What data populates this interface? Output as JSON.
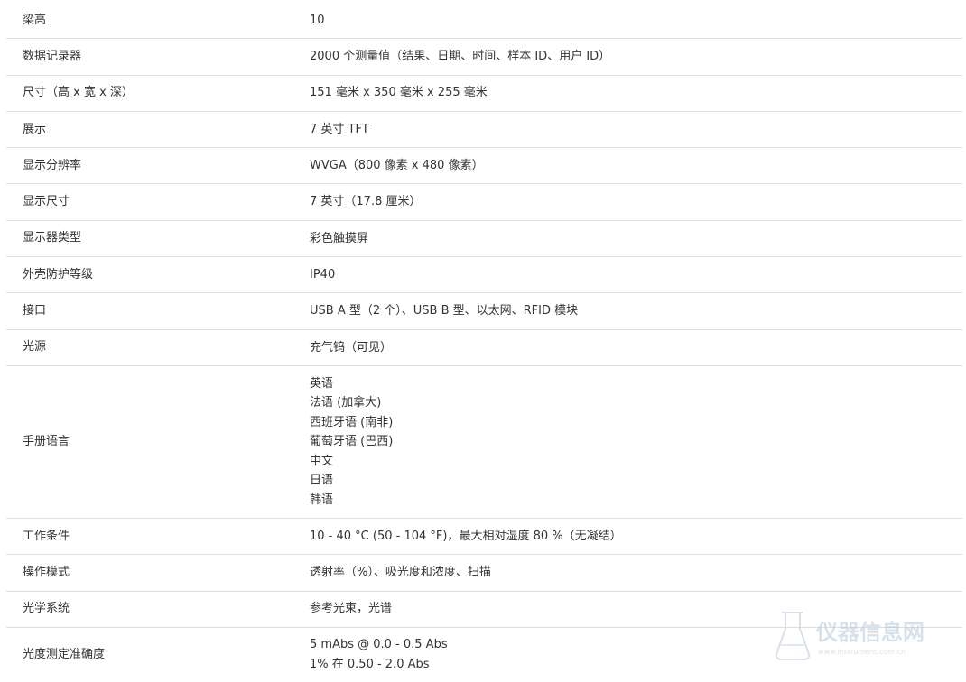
{
  "rows": [
    {
      "label": "梁高",
      "value": "10"
    },
    {
      "label": "数据记录器",
      "value": "2000 个测量值（结果、日期、时间、样本 ID、用户 ID）"
    },
    {
      "label": "尺寸（高 x 宽 x 深）",
      "value": "151 毫米 x 350 毫米 x 255 毫米"
    },
    {
      "label": "展示",
      "value": "7 英寸 TFT"
    },
    {
      "label": "显示分辨率",
      "value": "WVGA（800 像素 x 480 像素）"
    },
    {
      "label": "显示尺寸",
      "value": "7 英寸（17.8 厘米）"
    },
    {
      "label": "显示器类型",
      "value": "彩色触摸屏"
    },
    {
      "label": "外壳防护等级",
      "value": "IP40"
    },
    {
      "label": "接口",
      "value": "USB A 型（2 个）、USB B 型、以太网、RFID 模块"
    },
    {
      "label": "光源",
      "value": "充气钨（可见）"
    },
    {
      "label": "手册语言",
      "values": [
        "英语",
        "法语 (加拿大)",
        "西班牙语 (南非)",
        "葡萄牙语 (巴西)",
        "中文",
        "日语",
        "韩语"
      ]
    },
    {
      "label": "工作条件",
      "value": "10 - 40 °C (50 - 104 °F)，最大相对湿度 80 %（无凝结）"
    },
    {
      "label": "操作模式",
      "value": "透射率（%）、吸光度和浓度、扫描"
    },
    {
      "label": "光学系统",
      "value": "参考光束，光谱"
    },
    {
      "label": "光度测定准确度",
      "values": [
        "5 mAbs @ 0.0 - 0.5 Abs",
        "1% 在 0.50 - 2.0 Abs"
      ]
    }
  ],
  "watermark": {
    "text": "仪器信息网",
    "subtext": "www.instrument.com.cn",
    "color": "#b9c9d8",
    "icon": "flask-logo-icon"
  }
}
